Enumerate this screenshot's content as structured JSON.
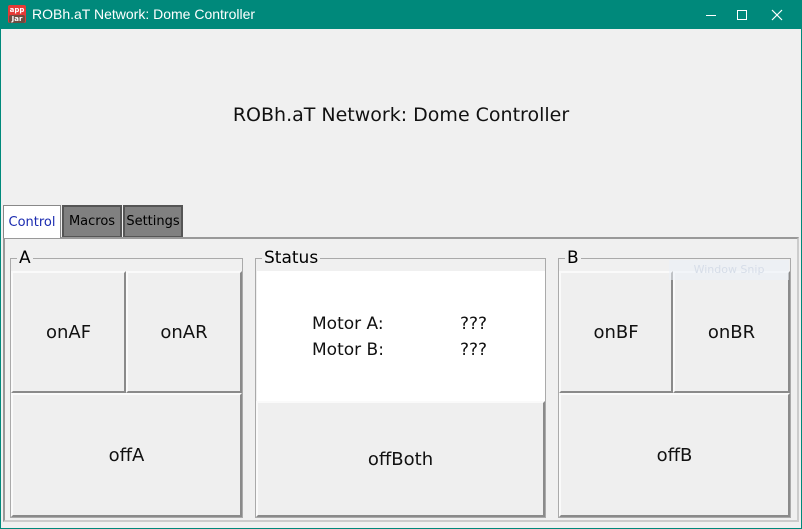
{
  "window": {
    "title": "ROBh.aT Network: Dome Controller",
    "icon_top": "app",
    "icon_bottom": "Jar",
    "controls": [
      "minimize-icon",
      "maximize-icon",
      "close-icon"
    ],
    "accent": "#00897b"
  },
  "header": {
    "title": "ROBh.aT Network: Dome Controller"
  },
  "tabs": [
    {
      "label": "Control",
      "active": true
    },
    {
      "label": "Macros",
      "active": false
    },
    {
      "label": "Settings",
      "active": false
    }
  ],
  "groupA": {
    "label": "A",
    "buttons": {
      "onAF": "onAF",
      "onAR": "onAR",
      "offA": "offA"
    }
  },
  "status": {
    "label": "Status",
    "motorA_label": "Motor A:",
    "motorA_value": "???",
    "motorB_label": "Motor B:",
    "motorB_value": "???",
    "offBoth": "offBoth"
  },
  "groupB": {
    "label": "B",
    "buttons": {
      "onBF": "onBF",
      "onBR": "onBR",
      "offB": "offB"
    }
  },
  "overlay": {
    "ghost_text": "Window Snip"
  }
}
